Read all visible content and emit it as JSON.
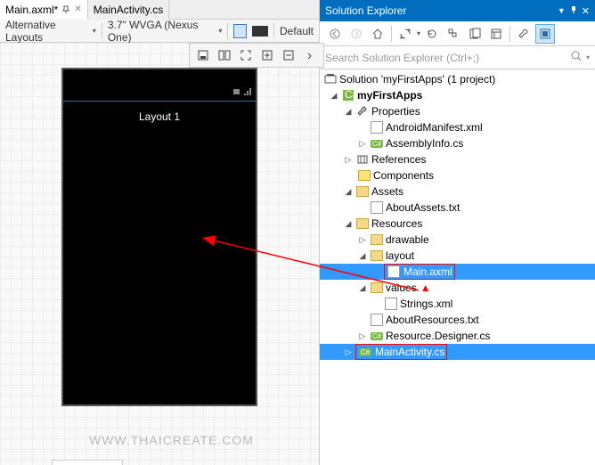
{
  "tabs": [
    {
      "label": "Main.axml*",
      "active": true
    },
    {
      "label": "MainActivity.cs",
      "active": false
    }
  ],
  "designerToolbar": {
    "alternativeLayouts": "Alternative Layouts",
    "deviceProfile": "3.7\" WVGA (Nexus One)",
    "themeLabel": "Default"
  },
  "canvas": {
    "layoutName": "Layout 1"
  },
  "solutionExplorer": {
    "title": "Solution Explorer",
    "searchPlaceholder": "Search Solution Explorer (Ctrl+;)",
    "tree": {
      "solution": "Solution 'myFirstApps' (1 project)",
      "project": "myFirstApps",
      "properties": "Properties",
      "androidManifest": "AndroidManifest.xml",
      "assemblyInfo": "AssemblyInfo.cs",
      "references": "References",
      "components": "Components",
      "assets": "Assets",
      "aboutAssets": "AboutAssets.txt",
      "resources": "Resources",
      "drawable": "drawable",
      "layout": "layout",
      "mainAxml": "Main.axml",
      "values": "values",
      "stringsXml": "Strings.xml",
      "aboutResources": "AboutResources.txt",
      "resourceDesigner": "Resource.Designer.cs",
      "mainActivity": "MainActivity.cs"
    }
  },
  "watermark": "WWW.THAICREATE.COM"
}
